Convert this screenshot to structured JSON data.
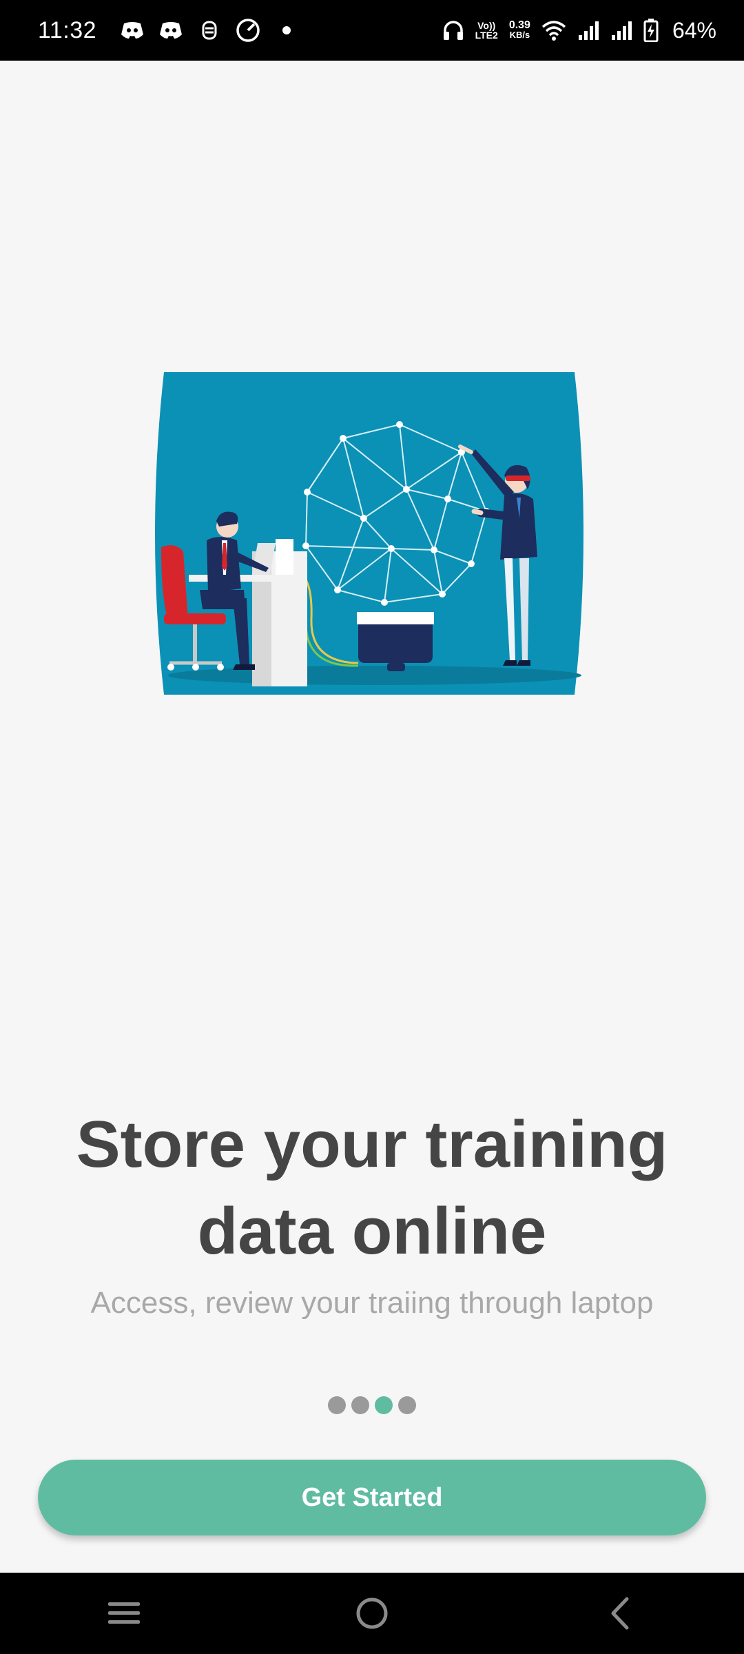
{
  "status_bar": {
    "time": "11:32",
    "left_icons": [
      "discord-icon",
      "discord-icon",
      "notification-icon",
      "speedometer-icon",
      "dot-icon"
    ],
    "volte_line1": "Vo))",
    "volte_line2": "LTE2",
    "net_speed_value": "0.39",
    "net_speed_unit": "KB/s",
    "battery_percent": "64%"
  },
  "onboarding": {
    "headline": "Store your training data online",
    "subtext": "Access, review your traiing through laptop",
    "page_count": 4,
    "active_page_index": 2,
    "cta_label": "Get Started"
  },
  "colors": {
    "accent": "#5fbca0",
    "illustration_bg": "#0b91b5",
    "headline": "#454545",
    "subtext": "#a8a8a8"
  },
  "nav_bar": {
    "icons": [
      "menu-icon",
      "home-icon",
      "back-icon"
    ]
  }
}
